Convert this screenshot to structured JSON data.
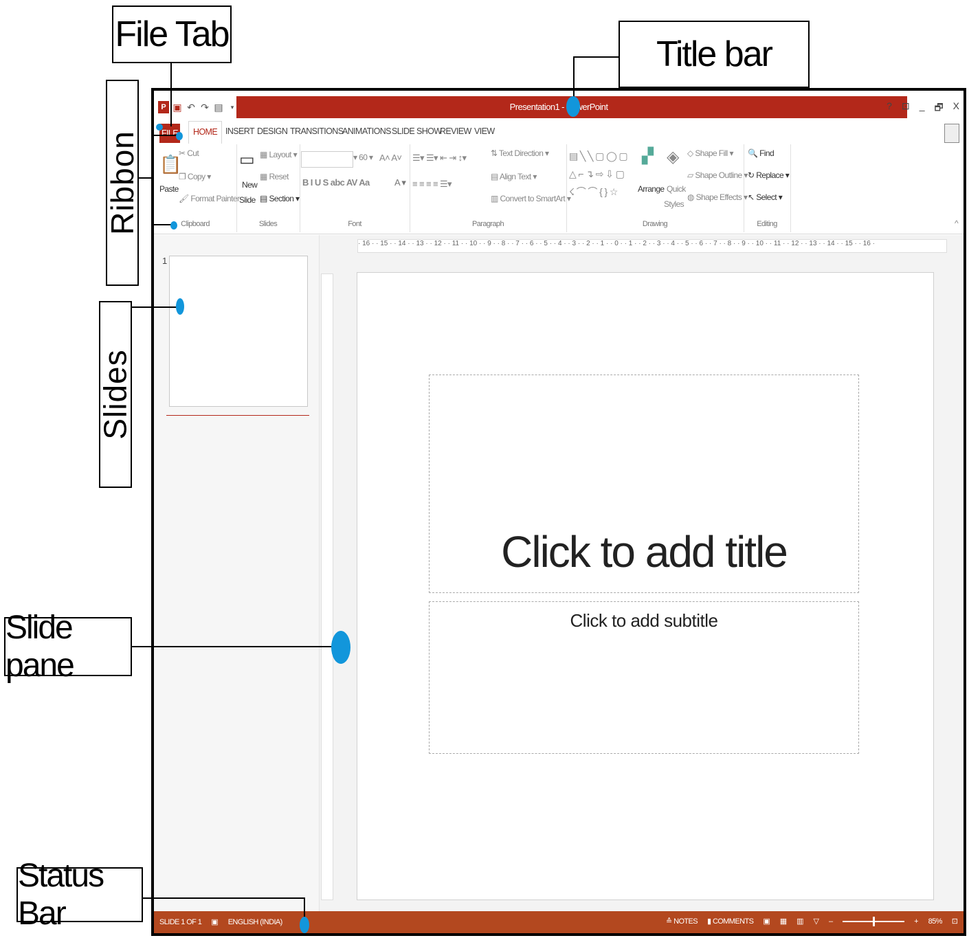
{
  "callouts": {
    "file_tab": "File Tab",
    "title_bar": "Title bar",
    "ribbon": "Ribbon",
    "slides": "Slides",
    "slide_pane": "Slide pane",
    "status_bar": "Status Bar"
  },
  "window": {
    "title": "Presentation1 - PowerPoint",
    "controls": [
      "?",
      "⊡",
      "_",
      "🗗",
      "X"
    ]
  },
  "tabs": [
    "FILE",
    "HOME",
    "INSERT",
    "DESIGN",
    "TRANSITIONS",
    "ANIMATIONS",
    "SLIDE SHOW",
    "REVIEW",
    "VIEW"
  ],
  "ribbon": {
    "clipboard": {
      "paste": "Paste",
      "cut": "Cut",
      "copy": "Copy",
      "format_painter": "Format Painter",
      "label": "Clipboard"
    },
    "slides": {
      "new_slide_1": "New",
      "new_slide_2": "Slide",
      "layout": "Layout",
      "reset": "Reset",
      "section": "Section",
      "label": "Slides"
    },
    "font": {
      "size": "60",
      "label": "Font"
    },
    "paragraph": {
      "text_direction": "Text Direction",
      "align_text": "Align Text",
      "convert": "Convert to SmartArt",
      "label": "Paragraph"
    },
    "drawing": {
      "arrange": "Arrange",
      "quick_1": "Quick",
      "quick_2": "Styles",
      "shape_fill": "Shape Fill",
      "shape_outline": "Shape Outline",
      "shape_effects": "Shape Effects",
      "label": "Drawing"
    },
    "editing": {
      "find": "Find",
      "replace": "Replace",
      "select": "Select",
      "label": "Editing"
    }
  },
  "thumbnail": {
    "number": "1"
  },
  "ruler": "· 16 · · 15 · · 14 · · 13 · · 12 · · 11 · · 10 · · 9 · · 8 · · 7 · · 6 · · 5 · · 4 · · 3 · · 2 · · 1 · · 0 · · 1 · · 2 · · 3 · · 4 · · 5 · · 6 · · 7 · · 8 · · 9 · · 10 · · 11 · · 12 · · 13 · · 14 · · 15 · · 16 ·",
  "slide": {
    "title_placeholder": "Click to add title",
    "subtitle_placeholder": "Click to add subtitle"
  },
  "status": {
    "slide_info": "SLIDE 1 OF 1",
    "language": "ENGLISH (INDIA)",
    "notes": "NOTES",
    "comments": "COMMENTS",
    "zoom": "85%",
    "zoom_level": 0.5
  },
  "colors": {
    "accent": "#b3281a",
    "status": "#b3481f",
    "marker": "#1296db"
  }
}
